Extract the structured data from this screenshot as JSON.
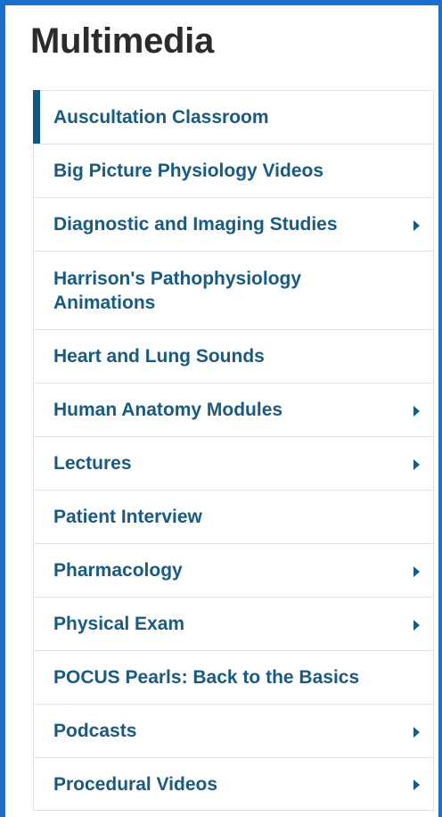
{
  "title": "Multimedia",
  "menu": {
    "items": [
      {
        "label": "Auscultation Classroom",
        "has_submenu": false,
        "active": true
      },
      {
        "label": "Big Picture Physiology Videos",
        "has_submenu": false
      },
      {
        "label": "Diagnostic and Imaging Studies",
        "has_submenu": true
      },
      {
        "label": "Harrison's Pathophysiology Animations",
        "has_submenu": false
      },
      {
        "label": "Heart and Lung Sounds",
        "has_submenu": false
      },
      {
        "label": "Human Anatomy Modules",
        "has_submenu": true
      },
      {
        "label": "Lectures",
        "has_submenu": true
      },
      {
        "label": "Patient Interview",
        "has_submenu": false
      },
      {
        "label": "Pharmacology",
        "has_submenu": true
      },
      {
        "label": "Physical Exam",
        "has_submenu": true
      },
      {
        "label": "POCUS Pearls: Back to the Basics",
        "has_submenu": false
      },
      {
        "label": "Podcasts",
        "has_submenu": true
      },
      {
        "label": "Procedural Videos",
        "has_submenu": true
      }
    ]
  },
  "colors": {
    "frame": "#1a6fd0",
    "link": "#175b85",
    "active_indicator": "#0e5a85",
    "title": "#2b2b2b"
  },
  "icons": {
    "submenu": "caret-right-icon"
  }
}
